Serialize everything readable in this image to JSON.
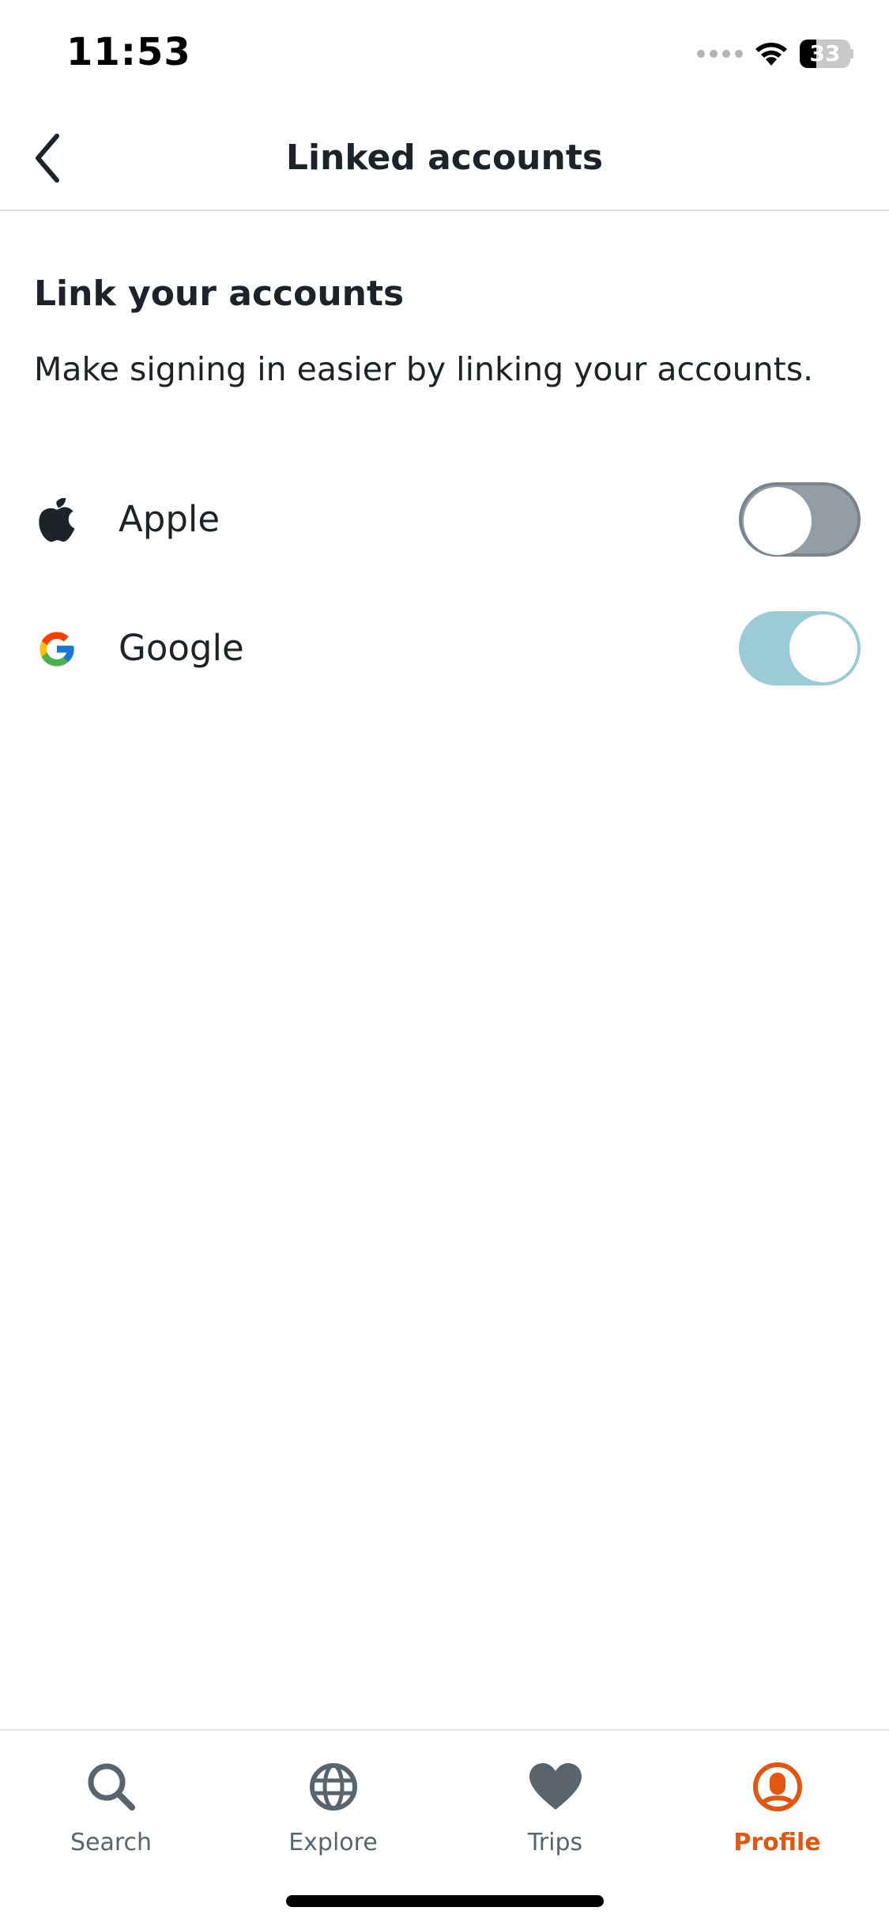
{
  "status_bar": {
    "time": "11:53",
    "battery_level": "33"
  },
  "header": {
    "title": "Linked accounts",
    "back_icon": "chevron-left-icon"
  },
  "section": {
    "title": "Link your accounts",
    "description": "Make signing in easier by linking your accounts."
  },
  "accounts": [
    {
      "label": "Apple",
      "icon": "apple-logo-icon",
      "linked": false
    },
    {
      "label": "Google",
      "icon": "google-logo-icon",
      "linked": true
    }
  ],
  "tab_bar": {
    "tabs": [
      {
        "label": "Search",
        "icon": "search-icon",
        "active": false
      },
      {
        "label": "Explore",
        "icon": "globe-icon",
        "active": false
      },
      {
        "label": "Trips",
        "icon": "heart-icon",
        "active": false
      },
      {
        "label": "Profile",
        "icon": "profile-icon",
        "active": true
      }
    ]
  },
  "colors": {
    "accent": "#e2560f",
    "toggle_on": "#9ccbd8",
    "toggle_off": "#949da3",
    "text_primary": "#1d2329",
    "tab_inactive": "#5a646c"
  }
}
